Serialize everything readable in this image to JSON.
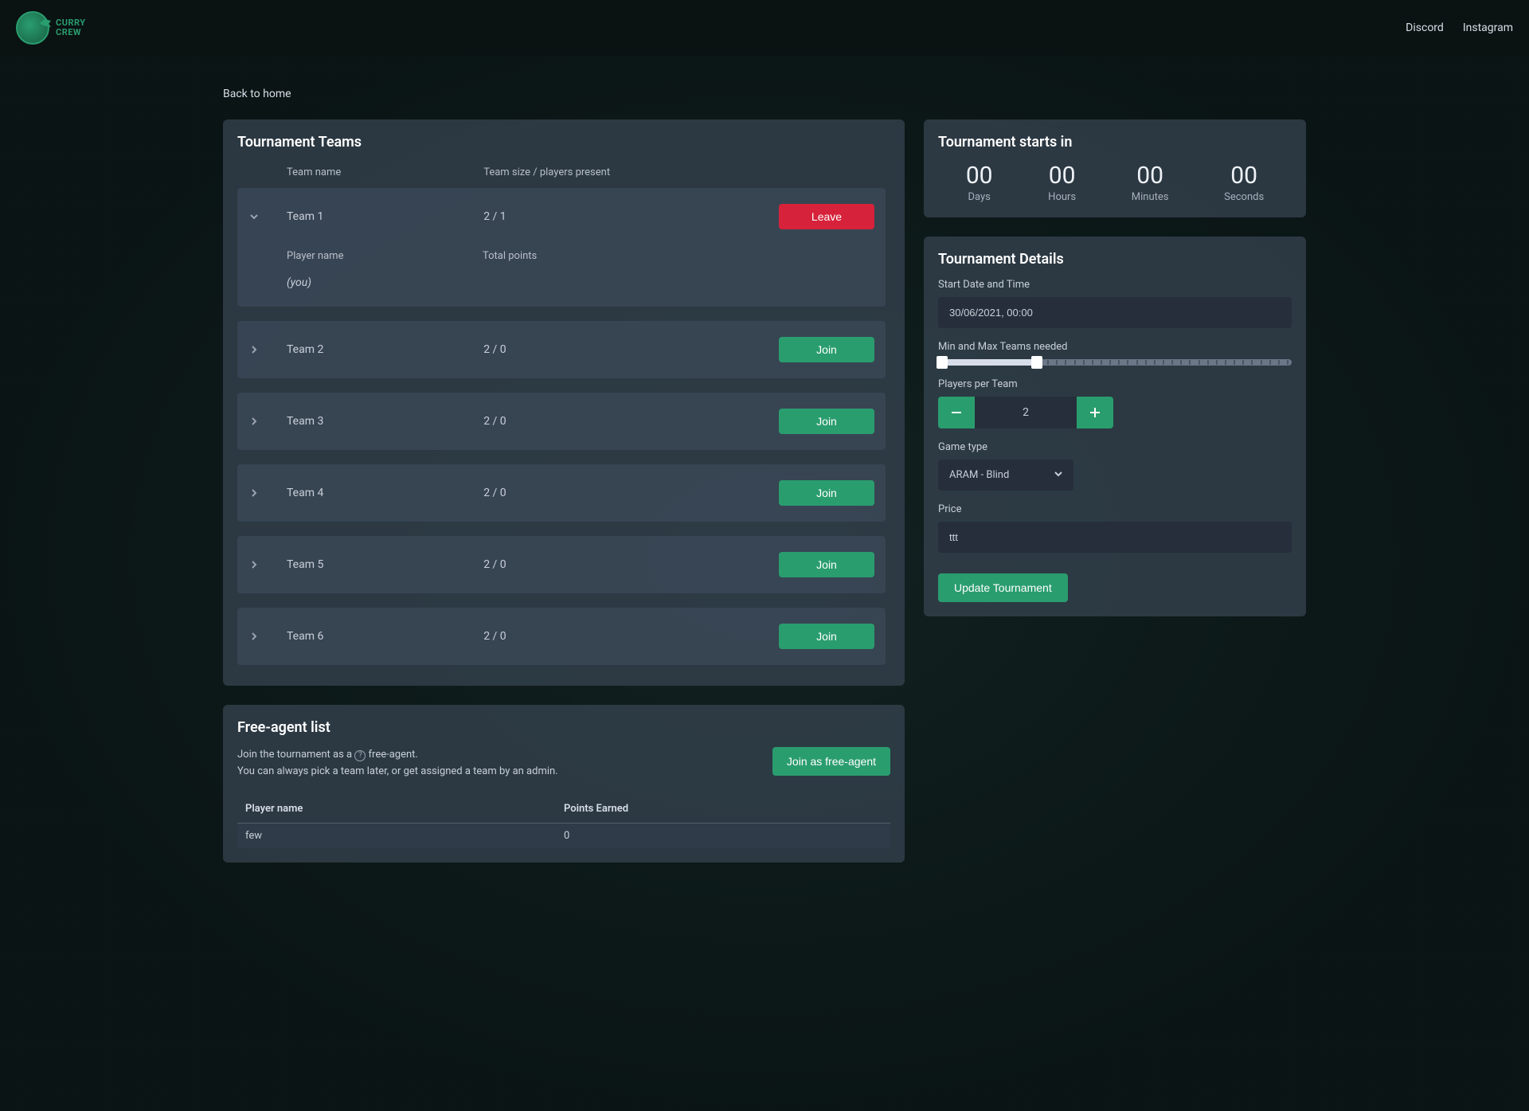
{
  "nav": {
    "brand_line1": "CURRY",
    "brand_line2": "CREW",
    "links": [
      "Discord",
      "Instagram"
    ]
  },
  "back_link": "Back to home",
  "teams_card": {
    "title": "Tournament Teams",
    "columns": {
      "name": "Team name",
      "size": "Team size / players present"
    },
    "leave_label": "Leave",
    "join_label": "Join",
    "player_columns": {
      "name": "Player name",
      "points": "Total points"
    },
    "you_label": "(you)",
    "rows": [
      {
        "name": "Team 1",
        "size": "2 / 1",
        "expanded": true,
        "mine": true
      },
      {
        "name": "Team 2",
        "size": "2 / 0",
        "expanded": false,
        "mine": false
      },
      {
        "name": "Team 3",
        "size": "2 / 0",
        "expanded": false,
        "mine": false
      },
      {
        "name": "Team 4",
        "size": "2 / 0",
        "expanded": false,
        "mine": false
      },
      {
        "name": "Team 5",
        "size": "2 / 0",
        "expanded": false,
        "mine": false
      },
      {
        "name": "Team 6",
        "size": "2 / 0",
        "expanded": false,
        "mine": false
      }
    ]
  },
  "free_agent": {
    "title": "Free-agent list",
    "desc_prefix": "Join the tournament as a ",
    "desc_suffix": " free-agent.",
    "desc_line2": "You can always pick a team later, or get assigned a team by an admin.",
    "button": "Join as free-agent",
    "columns": {
      "name": "Player name",
      "points": "Points Earned"
    },
    "rows": [
      {
        "name": "few",
        "points": "0"
      }
    ]
  },
  "countdown": {
    "title": "Tournament starts in",
    "segments": [
      {
        "value": "00",
        "label": "Days"
      },
      {
        "value": "00",
        "label": "Hours"
      },
      {
        "value": "00",
        "label": "Minutes"
      },
      {
        "value": "00",
        "label": "Seconds"
      }
    ]
  },
  "details": {
    "title": "Tournament Details",
    "start_label": "Start Date and Time",
    "start_value": "30/06/2021, 00:00",
    "teams_label": "Min and Max Teams needed",
    "players_label": "Players per Team",
    "players_value": "2",
    "gametype_label": "Game type",
    "gametype_value": "ARAM - Blind",
    "price_label": "Price",
    "price_value": "ttt",
    "update_button": "Update Tournament"
  }
}
